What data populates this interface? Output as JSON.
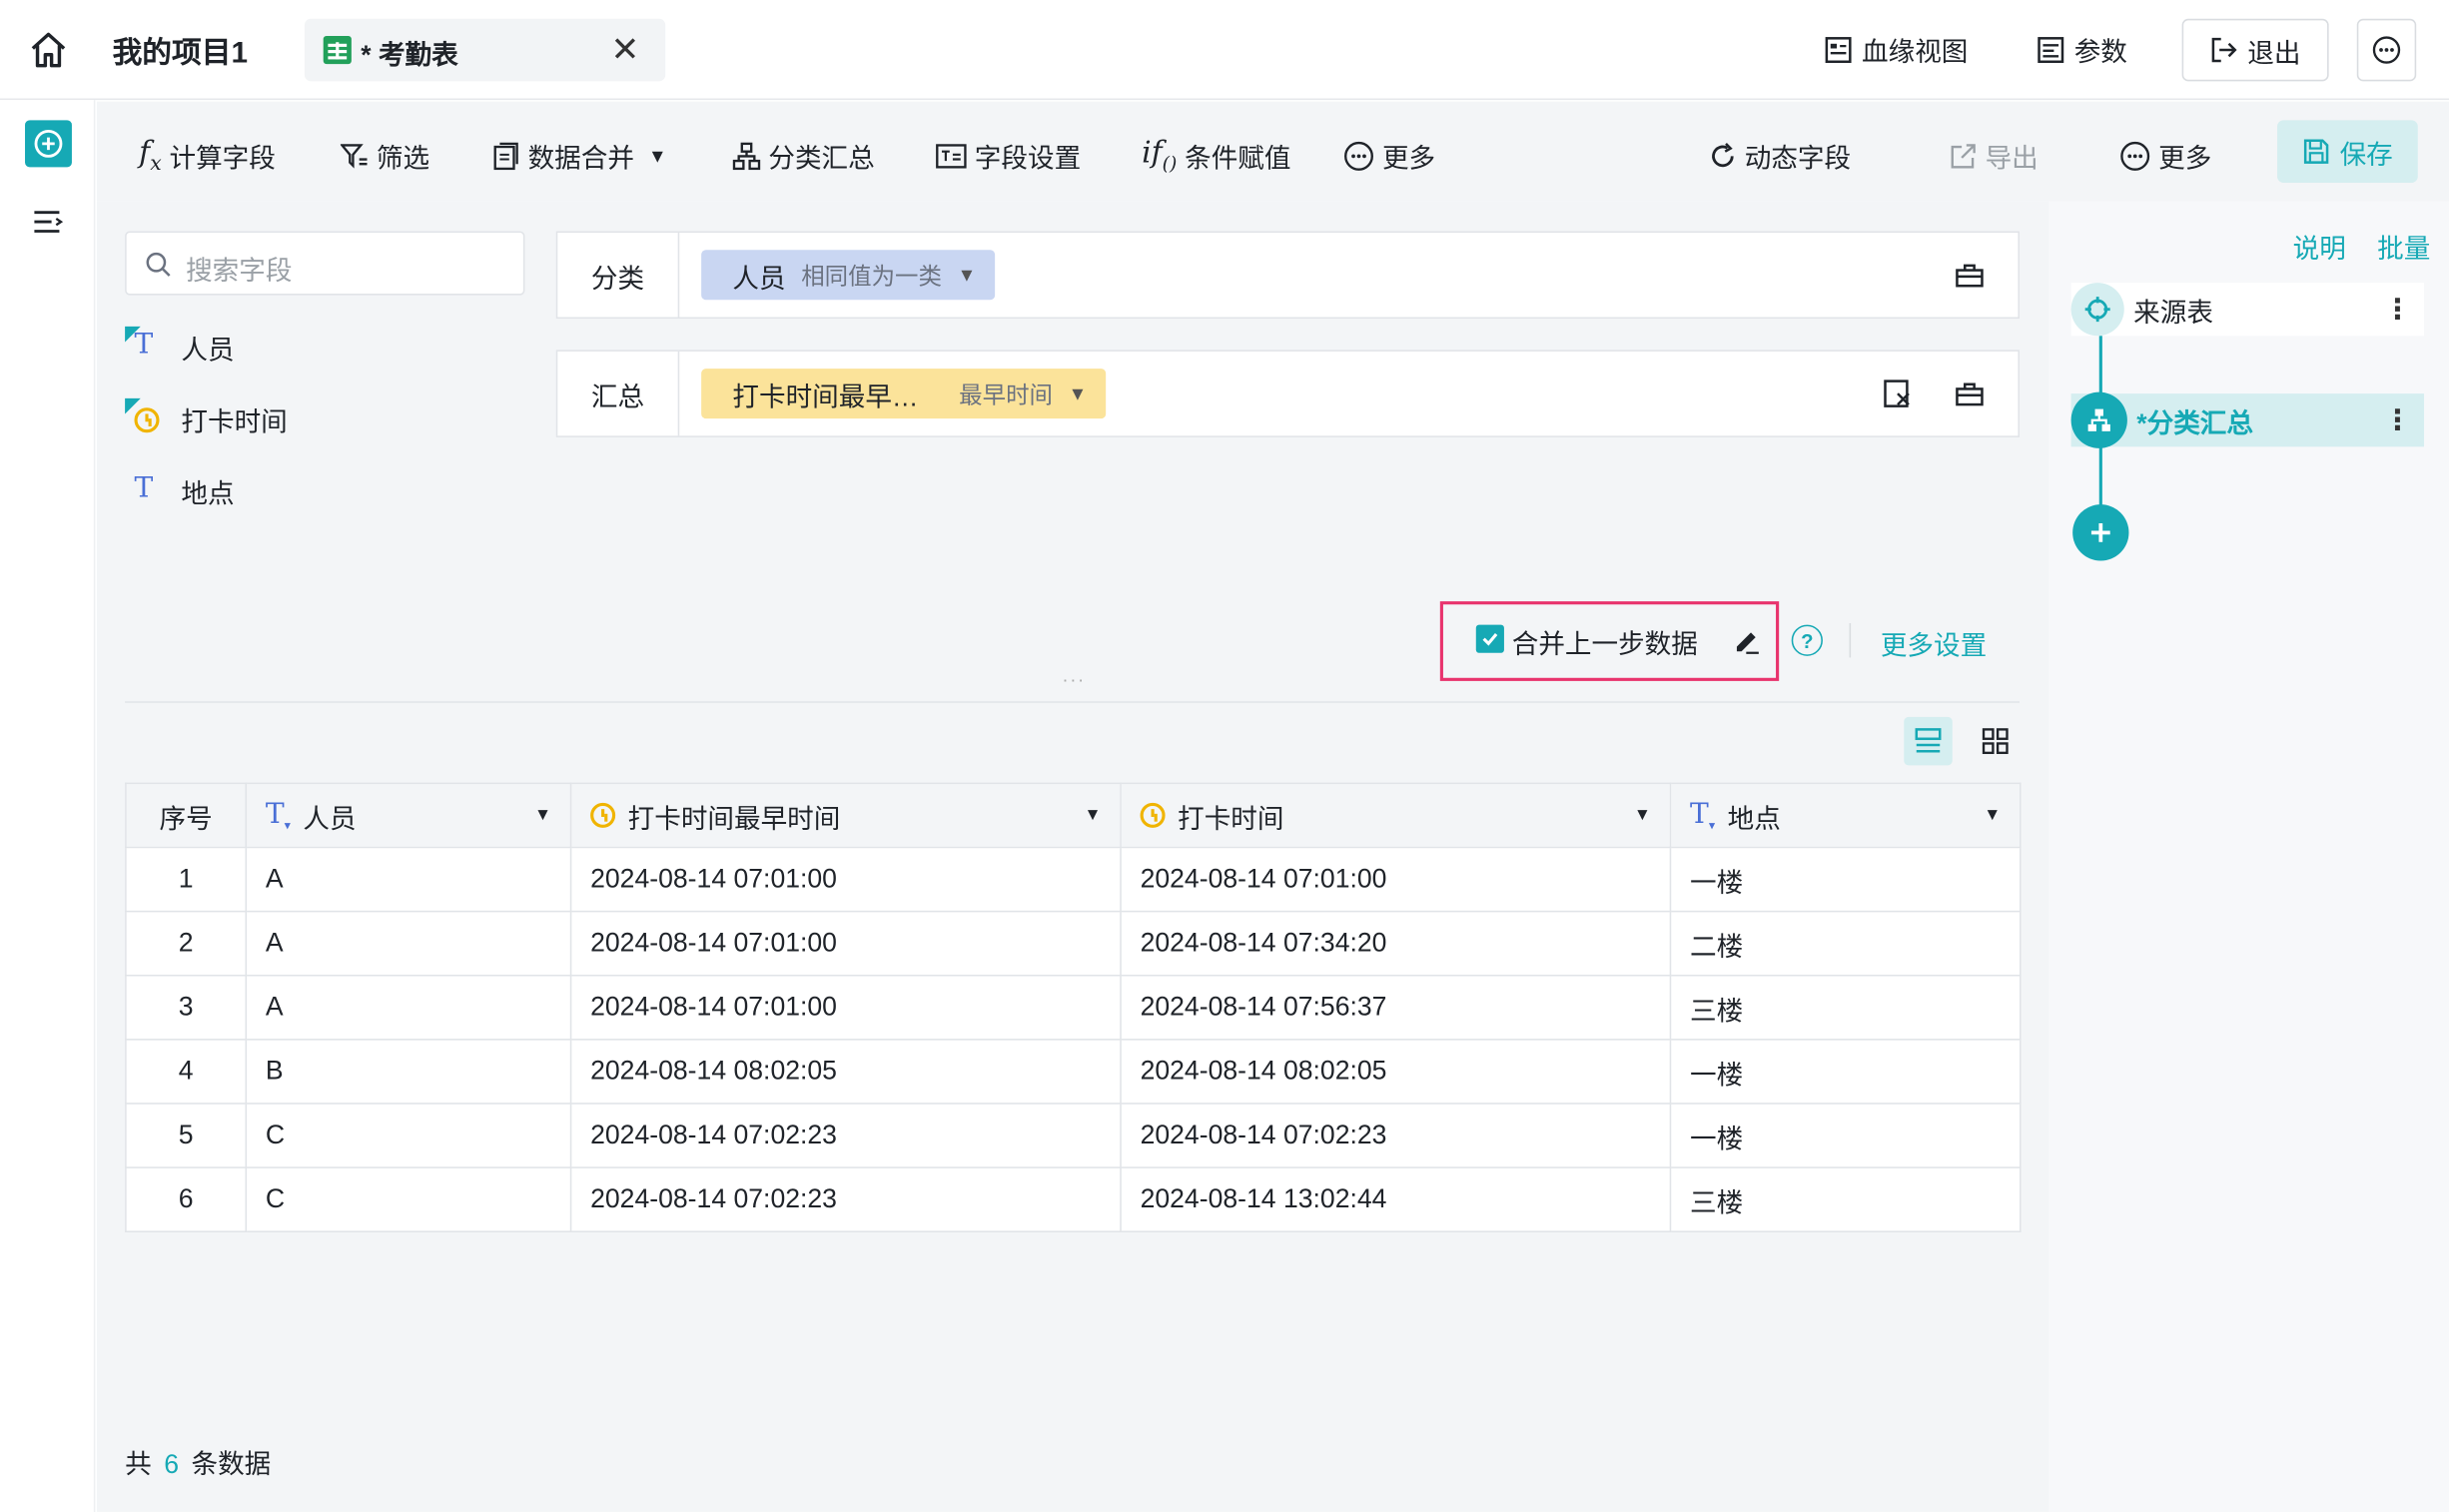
{
  "topbar": {
    "project_title": "我的项目1",
    "tab_label": "* 考勤表",
    "tab_close": "✕",
    "lineage_view": "血缘视图",
    "params": "参数",
    "exit": "退出"
  },
  "toolbar": {
    "calc_field": "计算字段",
    "filter": "筛选",
    "data_merge": "数据合并",
    "group_summary": "分类汇总",
    "field_settings": "字段设置",
    "conditional_assign": "条件赋值",
    "more": "更多",
    "dynamic_field": "动态字段",
    "export": "导出",
    "more2": "更多",
    "save": "保存"
  },
  "fields_panel": {
    "search_placeholder": "搜索字段",
    "fields": [
      "人员",
      "打卡时间",
      "地点"
    ]
  },
  "group_zone": {
    "label": "分类",
    "chip_name": "人员",
    "chip_sub": "相同值为一类"
  },
  "summary_zone": {
    "label": "汇总",
    "chip_name": "打卡时间最早…",
    "chip_sub": "最早时间"
  },
  "options": {
    "merge_prev": "合并上一步数据",
    "more_settings": "更多设置",
    "help": "?"
  },
  "table": {
    "headers": [
      "序号",
      "人员",
      "打卡时间最早时间",
      "打卡时间",
      "地点"
    ],
    "rows": [
      [
        "1",
        "A",
        "2024-08-14 07:01:00",
        "2024-08-14 07:01:00",
        "一楼"
      ],
      [
        "2",
        "A",
        "2024-08-14 07:01:00",
        "2024-08-14 07:34:20",
        "二楼"
      ],
      [
        "3",
        "A",
        "2024-08-14 07:01:00",
        "2024-08-14 07:56:37",
        "三楼"
      ],
      [
        "4",
        "B",
        "2024-08-14 08:02:05",
        "2024-08-14 08:02:05",
        "一楼"
      ],
      [
        "5",
        "C",
        "2024-08-14 07:02:23",
        "2024-08-14 07:02:23",
        "一楼"
      ],
      [
        "6",
        "C",
        "2024-08-14 07:02:23",
        "2024-08-14 13:02:44",
        "三楼"
      ]
    ]
  },
  "footer": {
    "prefix": "共",
    "count": "6",
    "suffix": "条数据"
  },
  "right_panel": {
    "explain": "说明",
    "batch": "批量",
    "nodes": [
      "来源表",
      "*分类汇总"
    ]
  },
  "colors": {
    "accent": "#16a9b5",
    "highlight": "#e8336d",
    "chip_blue": "#c9d6f2",
    "chip_yellow": "#fbe39a"
  }
}
